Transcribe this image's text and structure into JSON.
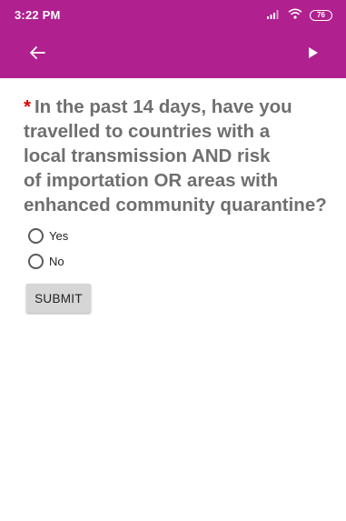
{
  "status_bar": {
    "time": "3:22 PM",
    "battery": "76",
    "icons": [
      "signal-icon",
      "wifi-icon",
      "battery-icon"
    ]
  },
  "app_bar": {
    "color": "#b0208f",
    "icons": [
      "back-arrow-icon",
      "play-icon"
    ]
  },
  "question": {
    "required_mark": "*",
    "lines": [
      "In the past 14 days, have you",
      "travelled to countries with a",
      "local transmission AND risk",
      "of importation OR areas with",
      "enhanced community quarantine?"
    ]
  },
  "options": [
    {
      "label": "Yes",
      "selected": false
    },
    {
      "label": "No",
      "selected": false
    }
  ],
  "submit_label": "SUBMIT"
}
